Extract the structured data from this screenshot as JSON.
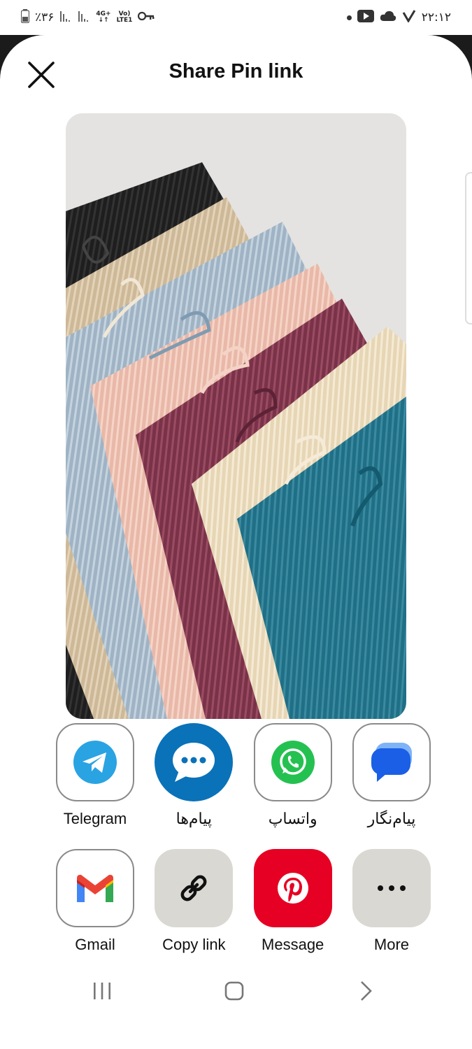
{
  "status_bar": {
    "battery_text": "٪۳۶",
    "network_top": "4G+",
    "network_bottom": "↓↑",
    "volte_top": "Vo)",
    "volte_bottom": "LTE1",
    "time": "۲۲:۱۲"
  },
  "sheet": {
    "title": "Share Pin link",
    "close_icon": "close-icon"
  },
  "share_targets": [
    {
      "label": "Telegram",
      "icon": "telegram-icon"
    },
    {
      "label": "پیام‌ها",
      "icon": "messages-icon"
    },
    {
      "label": "واتساپ",
      "icon": "whatsapp-icon"
    },
    {
      "label": "پیام‌نگار",
      "icon": "google-messages-icon"
    },
    {
      "label": "Gmail",
      "icon": "gmail-icon"
    },
    {
      "label": "Copy link",
      "icon": "link-icon"
    },
    {
      "label": "Message",
      "icon": "pinterest-icon"
    },
    {
      "label": "More",
      "icon": "more-icon"
    }
  ],
  "colors": {
    "pinterest_red": "#e60023",
    "telegram_blue": "#2aa3e3",
    "messages_blue": "#0a72b8",
    "whatsapp_green": "#25c150",
    "tile_grey": "#d9d8d2"
  }
}
